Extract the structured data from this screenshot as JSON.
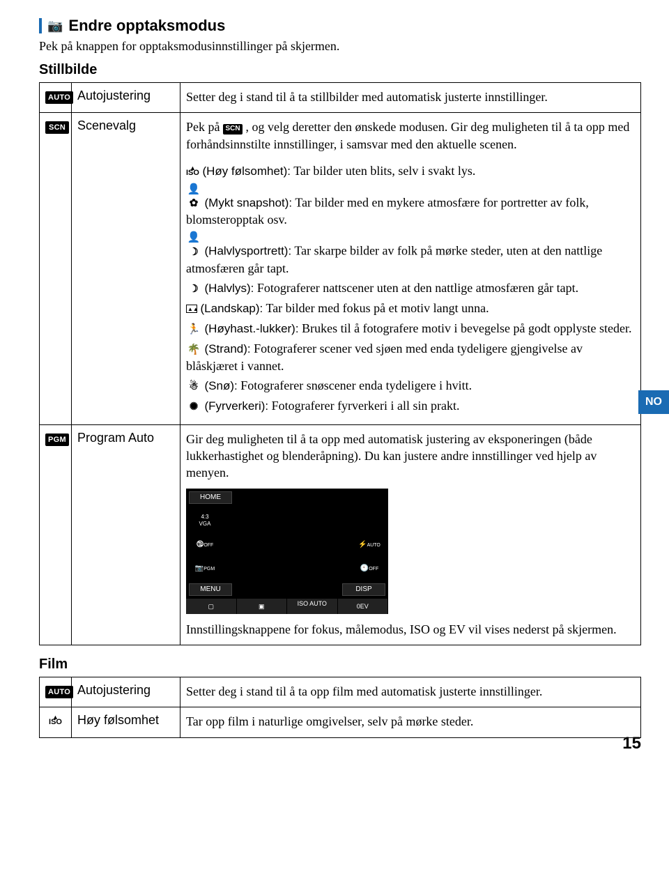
{
  "lang_tab": "NO",
  "page_number": "15",
  "section": {
    "title": "Endre opptaksmodus",
    "intro": "Pek på knappen for opptaksmodusinnstillinger på skjermen."
  },
  "still": {
    "heading": "Stillbilde",
    "rows": {
      "auto": {
        "icon": "AUTO",
        "name": "Autojustering",
        "desc": "Setter deg i stand til å ta stillbilder med automatisk justerte innstillinger."
      },
      "scn": {
        "icon": "SCN",
        "name": "Scenevalg",
        "desc_pre": "Pek på ",
        "desc_badge": "SCN",
        "desc_post": " , og velg deretter den ønskede modusen. Gir deg muligheten til å ta opp med forhåndsinnstilte innstillinger, i samsvar med den aktuelle scenen.",
        "scenes": {
          "iso": {
            "label": "(Høy følsomhet):",
            "text": " Tar bilder uten blits, selv i svakt lys."
          },
          "soft": {
            "label": "(Mykt snapshot):",
            "text": " Tar bilder med en mykere atmosfære for portretter av folk, blomsteropptak osv."
          },
          "twp": {
            "label": "(Halvlysportrett):",
            "text": " Tar skarpe bilder av folk på mørke steder, uten at den nattlige atmosfæren går tapt."
          },
          "tw": {
            "label": "(Halvlys):",
            "text": " Fotograferer nattscener uten at den nattlige atmosfæren går tapt."
          },
          "land": {
            "label": "(Landskap):",
            "text": " Tar bilder med fokus på et motiv langt unna."
          },
          "hss": {
            "label": "(Høyhast.-lukker):",
            "text": " Brukes til å fotografere motiv i bevegelse på godt opplyste steder."
          },
          "beach": {
            "label": "(Strand):",
            "text": " Fotograferer scener ved sjøen med enda tydeligere gjengivelse av blåskjæret i vannet."
          },
          "snow": {
            "label": "(Snø):",
            "text": " Fotograferer snøscener enda tydeligere i hvitt."
          },
          "fire": {
            "label": "(Fyrverkeri):",
            "text": " Fotograferer fyrverkeri i all sin prakt."
          }
        }
      },
      "pgm": {
        "icon": "PGM",
        "name": "Program Auto",
        "desc": "Gir deg muligheten til å ta opp med automatisk justering av eksponeringen (både lukkerhastighet og blenderåpning). Du kan justere andre innstillinger ved hjelp av menyen.",
        "lcd": {
          "home": "HOME",
          "menu": "MENU",
          "disp": "DISP",
          "vga": "VGA",
          "off1": "OFF",
          "pgm": "PGM",
          "flash": "AUTO",
          "timer": "OFF",
          "b1": "",
          "b2": "",
          "b3": "ISO\nAUTO",
          "b4": "0EV"
        },
        "note": "Innstillingsknappene for fokus, målemodus, ISO og EV vil vises nederst på skjermen."
      }
    }
  },
  "film": {
    "heading": "Film",
    "rows": {
      "auto": {
        "icon": "AUTO",
        "name": "Autojustering",
        "desc": "Setter deg i stand til å ta opp film med automatisk justerte innstillinger."
      },
      "iso": {
        "icon": "ISO",
        "name": "Høy følsomhet",
        "desc": "Tar opp film i naturlige omgivelser, selv på mørke steder."
      }
    }
  }
}
